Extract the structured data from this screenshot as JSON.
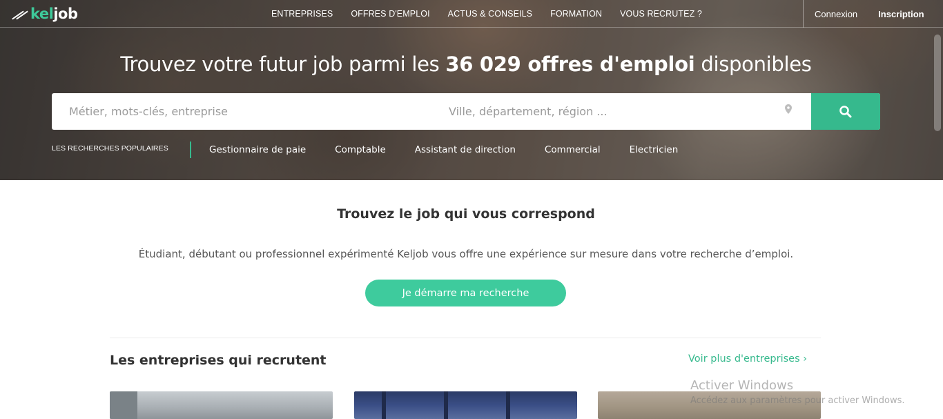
{
  "nav": {
    "logo_part1": "kel",
    "logo_part2": "job",
    "items": [
      "ENTREPRISES",
      "OFFRES D'EMPLOI",
      "ACTUS & CONSEILS",
      "FORMATION",
      "VOUS RECRUTEZ ?"
    ],
    "login": "Connexion",
    "signup": "Inscription"
  },
  "hero": {
    "headline_pre": "Trouvez votre futur job parmi les ",
    "headline_bold": "36 029 offres d'emploi",
    "headline_post": " disponibles"
  },
  "search": {
    "what_placeholder": "Métier, mots-clés, entreprise",
    "where_placeholder": "Ville, département, région ...",
    "button_icon": "search-icon",
    "pin_icon": "map-pin-icon"
  },
  "popular": {
    "label": "LES RECHERCHES POPULAIRES",
    "links": [
      "Gestionnaire de paie",
      "Comptable",
      "Assistant de direction",
      "Commercial",
      "Electricien"
    ]
  },
  "intro": {
    "title": "Trouvez le job qui vous correspond",
    "description": "Étudiant, débutant ou professionnel expérimenté Keljob vous offre une expérience sur mesure dans votre recherche d’emploi.",
    "cta": "Je démarre ma recherche"
  },
  "companies": {
    "title": "Les entreprises qui recrutent",
    "more_link": "Voir plus d'entreprises ›"
  },
  "watermark": {
    "title": "Activer Windows",
    "subtitle": "Accédez aux paramètres pour activer Windows."
  },
  "colors": {
    "accent": "#36b98d",
    "cta": "#3ecb9d"
  }
}
